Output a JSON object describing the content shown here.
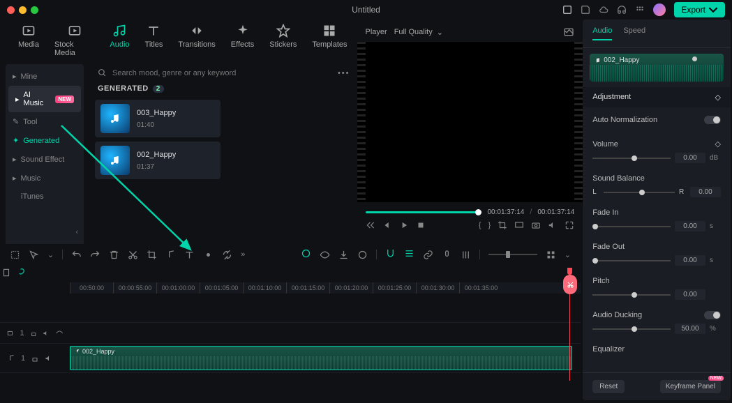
{
  "titlebar": {
    "title": "Untitled",
    "export": "Export"
  },
  "mediaTabs": [
    {
      "id": "media",
      "label": "Media"
    },
    {
      "id": "stock",
      "label": "Stock Media"
    },
    {
      "id": "audio",
      "label": "Audio"
    },
    {
      "id": "titles",
      "label": "Titles"
    },
    {
      "id": "transitions",
      "label": "Transitions"
    },
    {
      "id": "effects",
      "label": "Effects"
    },
    {
      "id": "stickers",
      "label": "Stickers"
    },
    {
      "id": "templates",
      "label": "Templates"
    }
  ],
  "sidebar": {
    "items": [
      {
        "label": "Mine",
        "icon": "user"
      },
      {
        "label": "AI Music",
        "badge": "NEW",
        "selected": true
      },
      {
        "label": "Tool",
        "icon": "tool"
      },
      {
        "label": "Generated",
        "accent": true,
        "icon": "sparkle"
      },
      {
        "label": "Sound Effect",
        "expandable": true
      },
      {
        "label": "Music",
        "expandable": true
      },
      {
        "label": "iTunes"
      }
    ]
  },
  "search": {
    "placeholder": "Search mood, genre or any keyword"
  },
  "generated": {
    "header": "GENERATED",
    "count": "2",
    "items": [
      {
        "name": "003_Happy",
        "duration": "01:40"
      },
      {
        "name": "002_Happy",
        "duration": "01:37"
      }
    ]
  },
  "player": {
    "label": "Player",
    "quality": "Full Quality",
    "currentTime": "00:01:37:14",
    "totalTime": "00:01:37:14"
  },
  "rightPanel": {
    "tabs": [
      "Audio",
      "Speed"
    ],
    "clipName": "002_Happy",
    "adjustment": "Adjustment",
    "controls": {
      "autoNorm": {
        "label": "Auto Normalization"
      },
      "volume": {
        "label": "Volume",
        "value": "0.00",
        "unit": "dB"
      },
      "balance": {
        "label": "Sound Balance",
        "l": "L",
        "r": "R",
        "value": "0.00"
      },
      "fadeIn": {
        "label": "Fade In",
        "value": "0.00",
        "unit": "s"
      },
      "fadeOut": {
        "label": "Fade Out",
        "value": "0.00",
        "unit": "s"
      },
      "pitch": {
        "label": "Pitch",
        "value": "0.00"
      },
      "ducking": {
        "label": "Audio Ducking",
        "value": "50.00",
        "unit": "%"
      },
      "equalizer": {
        "label": "Equalizer"
      }
    },
    "reset": "Reset",
    "keyframe": "Keyframe Panel",
    "kfBadge": "NEW"
  },
  "ruler": {
    "ticks": [
      "00:50:00",
      "00:00:55:00",
      "00:01:00:00",
      "00:01:05:00",
      "00:01:10:00",
      "00:01:15:00",
      "00:01:20:00",
      "00:01:25:00",
      "00:01:30:00",
      "00:01:35:00"
    ]
  },
  "timeline": {
    "clipName": "002_Happy"
  }
}
